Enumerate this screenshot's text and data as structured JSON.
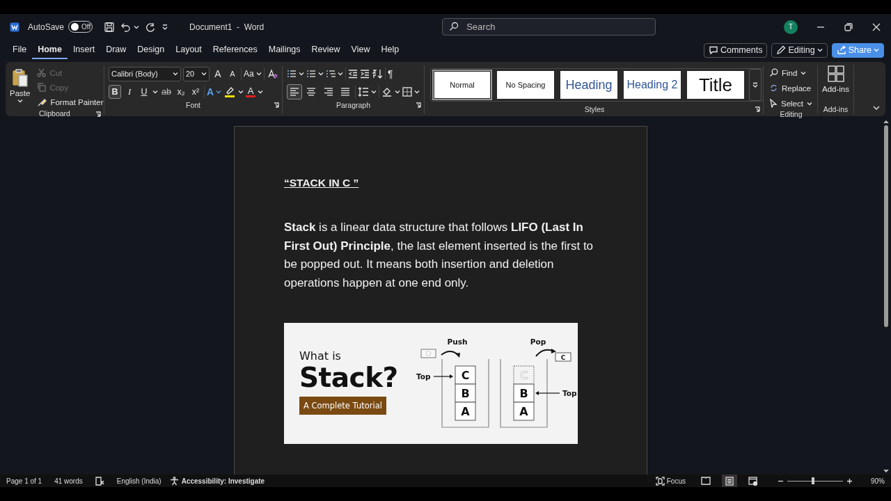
{
  "title_bar": {
    "autosave": {
      "label": "AutoSave",
      "state_text": "Off",
      "on": false
    },
    "document_title": "Document1  -  Word",
    "search": {
      "placeholder": "Search"
    },
    "avatar": "T"
  },
  "menu": {
    "tabs": [
      {
        "label": "File",
        "selected": false
      },
      {
        "label": "Home",
        "selected": true
      },
      {
        "label": "Insert",
        "selected": false
      },
      {
        "label": "Draw",
        "selected": false
      },
      {
        "label": "Design",
        "selected": false
      },
      {
        "label": "Layout",
        "selected": false
      },
      {
        "label": "References",
        "selected": false
      },
      {
        "label": "Mailings",
        "selected": false
      },
      {
        "label": "Review",
        "selected": false
      },
      {
        "label": "View",
        "selected": false
      },
      {
        "label": "Help",
        "selected": false
      }
    ],
    "buttons": [
      {
        "kind": "comments",
        "label": "Comments"
      },
      {
        "kind": "editing",
        "label": "Editing"
      },
      {
        "kind": "share",
        "label": "Share"
      }
    ]
  },
  "ribbon": {
    "clipboard": {
      "label": "Clipboard",
      "paste": "Paste",
      "tools": [
        {
          "kind": "cut",
          "label": "Cut",
          "disabled": true
        },
        {
          "kind": "copy",
          "label": "Copy",
          "disabled": true
        },
        {
          "kind": "painter",
          "label": "Format Painter",
          "disabled": false
        }
      ]
    },
    "font": {
      "label": "Font",
      "font_name": "Calibri (Body)",
      "font_size": "20",
      "grow": "A",
      "shrink": "A",
      "change_case": "Aa",
      "text_effects": "A",
      "font_color": "A",
      "format_buttons": [
        {
          "kind": "bold",
          "label": "B",
          "selected": true
        },
        {
          "kind": "italic",
          "label": "I",
          "selected": false
        },
        {
          "kind": "underline",
          "label": "U",
          "selected": false
        },
        {
          "kind": "strike",
          "label": "ab",
          "selected": false
        },
        {
          "kind": "subscript",
          "label": "x₂",
          "selected": false
        },
        {
          "kind": "superscript",
          "label": "x²",
          "selected": false
        }
      ]
    },
    "paragraph": {
      "label": "Paragraph",
      "show_marks": "¶",
      "alignments": [
        {
          "kind": "left",
          "selected": true
        },
        {
          "kind": "center",
          "selected": false
        },
        {
          "kind": "right",
          "selected": false
        },
        {
          "kind": "justify",
          "selected": false
        }
      ]
    },
    "styles": {
      "label": "Styles",
      "items": [
        {
          "kind": "normal",
          "label": "Normal",
          "selected": true
        },
        {
          "kind": "no-spacing",
          "label": "No Spacing",
          "selected": false
        },
        {
          "kind": "heading1",
          "label": "Heading",
          "selected": false
        },
        {
          "kind": "heading2",
          "label": "Heading 2",
          "selected": false
        },
        {
          "kind": "title",
          "label": "Title",
          "selected": false
        }
      ]
    },
    "editing": {
      "label": "Editing",
      "tools": [
        {
          "kind": "find",
          "label": "Find"
        },
        {
          "kind": "replace",
          "label": "Replace"
        },
        {
          "kind": "select",
          "label": "Select"
        }
      ]
    },
    "addins": {
      "label": "Add-ins",
      "button": "Add-ins"
    }
  },
  "document": {
    "heading": "“STACK IN C ”",
    "paragraph": "**Stack** is a linear data structure that follows **LIFO (Last In First Out) Principle**, the last element inserted is the first to be popped out. It means both insertion and deletion operations happen at one end only.",
    "figure": {
      "heading": "What is",
      "title": "Stack?",
      "badge": "A Complete Tutorial",
      "stacks": [
        {
          "action": "Push",
          "top_label": "Top",
          "kind": "push",
          "outside": {
            "kind": "ghost"
          },
          "cells": [
            {
              "label": "C",
              "kind": "solid"
            },
            {
              "label": "B",
              "kind": "solid"
            },
            {
              "label": "A",
              "kind": "solid"
            }
          ]
        },
        {
          "action": "Pop",
          "top_label": "Top",
          "kind": "pop",
          "outside": {
            "kind": "solid",
            "label": "C"
          },
          "cells": [
            {
              "label": "C",
              "kind": "ghost"
            },
            {
              "label": "B",
              "kind": "solid"
            },
            {
              "label": "A",
              "kind": "solid"
            }
          ]
        }
      ]
    }
  },
  "status_bar": {
    "page": "Page 1 of 1",
    "words": "41 words",
    "language": "English (India)",
    "accessibility": "Accessibility: Investigate",
    "focus": "Focus",
    "views": [
      {
        "kind": "read",
        "selected": false
      },
      {
        "kind": "print",
        "selected": true
      },
      {
        "kind": "web",
        "selected": false
      }
    ],
    "zoom": {
      "level": 0.46,
      "reading": "90%"
    }
  }
}
